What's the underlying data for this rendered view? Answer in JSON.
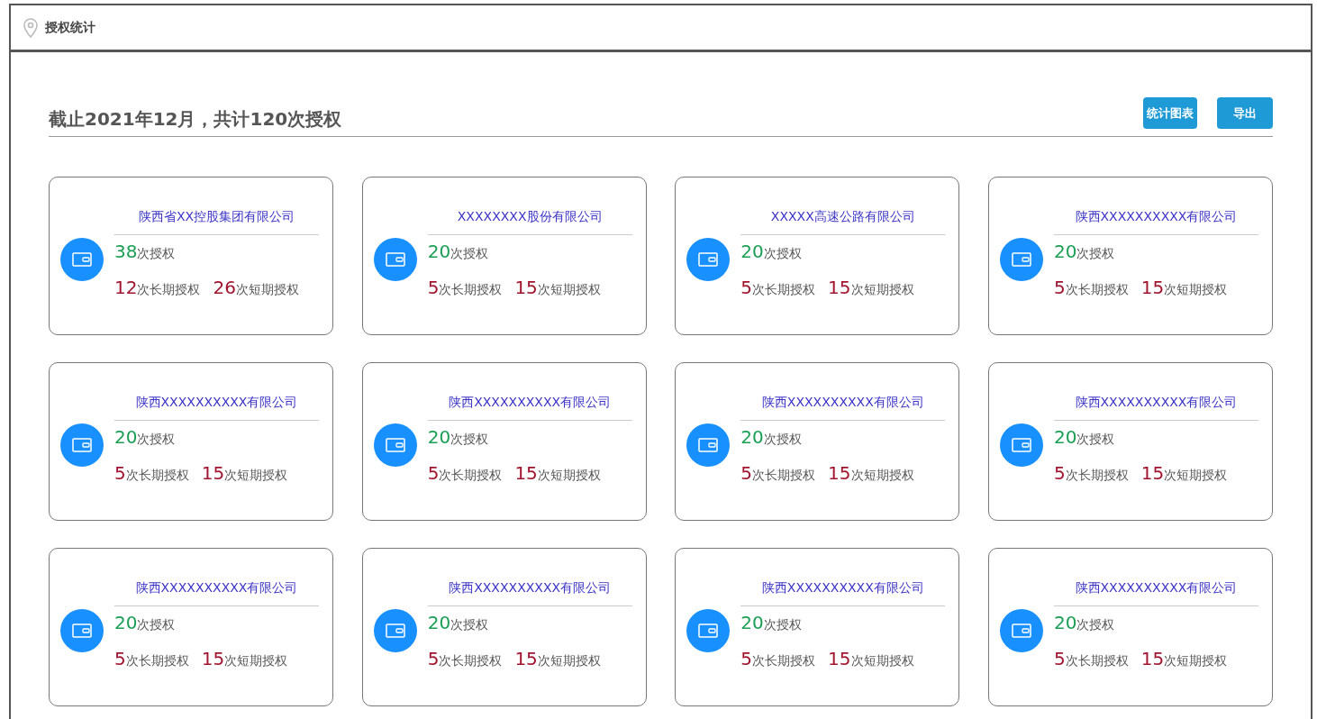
{
  "header": {
    "title": "授权统计"
  },
  "summary": {
    "title": "截止2021年12月，共计120次授权",
    "buttons": [
      "统计图表",
      "导出"
    ]
  },
  "companies": [
    {
      "name": "陕西省XX控股集团有限公司",
      "total": {
        "count": "38",
        "unit": "次授权"
      },
      "long_term": {
        "count": "12",
        "unit": "次长期授权"
      },
      "short_term": {
        "count": "26",
        "unit": "次短期授权"
      }
    },
    {
      "name": "XXXXXXXX股份有限公司",
      "total": {
        "count": "20",
        "unit": "次授权"
      },
      "long_term": {
        "count": "5",
        "unit": "次长期授权"
      },
      "short_term": {
        "count": "15",
        "unit": "次短期授权"
      }
    },
    {
      "name": "XXXXX高速公路有限公司",
      "total": {
        "count": "20",
        "unit": "次授权"
      },
      "long_term": {
        "count": "5",
        "unit": "次长期授权"
      },
      "short_term": {
        "count": "15",
        "unit": "次短期授权"
      }
    },
    {
      "name": "陕西XXXXXXXXXX有限公司",
      "total": {
        "count": "20",
        "unit": "次授权"
      },
      "long_term": {
        "count": "5",
        "unit": "次长期授权"
      },
      "short_term": {
        "count": "15",
        "unit": "次短期授权"
      }
    },
    {
      "name": "陕西XXXXXXXXXX有限公司",
      "total": {
        "count": "20",
        "unit": "次授权"
      },
      "long_term": {
        "count": "5",
        "unit": "次长期授权"
      },
      "short_term": {
        "count": "15",
        "unit": "次短期授权"
      }
    },
    {
      "name": "陕西XXXXXXXXXX有限公司",
      "total": {
        "count": "20",
        "unit": "次授权"
      },
      "long_term": {
        "count": "5",
        "unit": "次长期授权"
      },
      "short_term": {
        "count": "15",
        "unit": "次短期授权"
      }
    },
    {
      "name": "陕西XXXXXXXXXX有限公司",
      "total": {
        "count": "20",
        "unit": "次授权"
      },
      "long_term": {
        "count": "5",
        "unit": "次长期授权"
      },
      "short_term": {
        "count": "15",
        "unit": "次短期授权"
      }
    },
    {
      "name": "陕西XXXXXXXXXX有限公司",
      "total": {
        "count": "20",
        "unit": "次授权"
      },
      "long_term": {
        "count": "5",
        "unit": "次长期授权"
      },
      "short_term": {
        "count": "15",
        "unit": "次短期授权"
      }
    },
    {
      "name": "陕西XXXXXXXXXX有限公司",
      "total": {
        "count": "20",
        "unit": "次授权"
      },
      "long_term": {
        "count": "5",
        "unit": "次长期授权"
      },
      "short_term": {
        "count": "15",
        "unit": "次短期授权"
      }
    },
    {
      "name": "陕西XXXXXXXXXX有限公司",
      "total": {
        "count": "20",
        "unit": "次授权"
      },
      "long_term": {
        "count": "5",
        "unit": "次长期授权"
      },
      "short_term": {
        "count": "15",
        "unit": "次短期授权"
      }
    },
    {
      "name": "陕西XXXXXXXXXX有限公司",
      "total": {
        "count": "20",
        "unit": "次授权"
      },
      "long_term": {
        "count": "5",
        "unit": "次长期授权"
      },
      "short_term": {
        "count": "15",
        "unit": "次短期授权"
      }
    },
    {
      "name": "陕西XXXXXXXXXX有限公司",
      "total": {
        "count": "20",
        "unit": "次授权"
      },
      "long_term": {
        "count": "5",
        "unit": "次长期授权"
      },
      "short_term": {
        "count": "15",
        "unit": "次短期授权"
      }
    }
  ]
}
